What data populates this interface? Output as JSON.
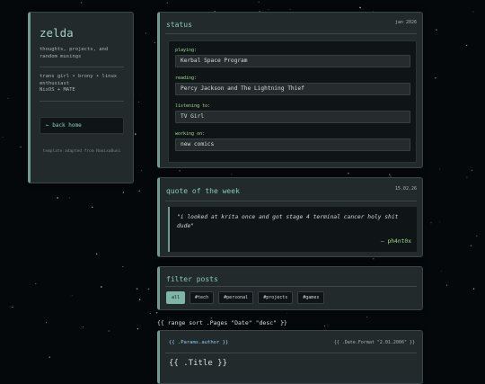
{
  "sidebar": {
    "title": "zelda",
    "tagline": "thoughts, projects, and random musings",
    "bio": [
      "trans girl • brony • linux enthusiast",
      "NixOS + MATE"
    ],
    "back_home": "← back home",
    "credit": "template adapted from NomixaBuni"
  },
  "status": {
    "title": "status",
    "date": "jan 2026",
    "items": [
      {
        "label": "playing:",
        "value": "Kerbal Space Program"
      },
      {
        "label": "reading:",
        "value": "Percy Jackson and The Lightning Thief"
      },
      {
        "label": "listening to:",
        "value": "TV Girl"
      },
      {
        "label": "working on:",
        "value": "new comics"
      }
    ]
  },
  "quote": {
    "title": "quote of the week",
    "date": "15.02.26",
    "text": "\"i looked at krita once and got stage 4 terminal cancer holy shit dude\"",
    "author": "— ph4nt0x"
  },
  "filter": {
    "title": "filter posts",
    "tags": [
      "all",
      "#tech",
      "#personal",
      "#projects",
      "#games"
    ],
    "active": "all"
  },
  "template": {
    "range_line": "{{ range sort .Pages \"Date\" \"desc\" }}",
    "post_author": "{{ .Params.author }}",
    "post_date": "{{ .Date.Format \"2.01.2006\" }}",
    "post_title": "{{ .Title }}"
  },
  "colors": {
    "background": "#05080b",
    "card": "#222a2c",
    "accent": "#88c9b4",
    "label_green": "#9fdc8e"
  }
}
